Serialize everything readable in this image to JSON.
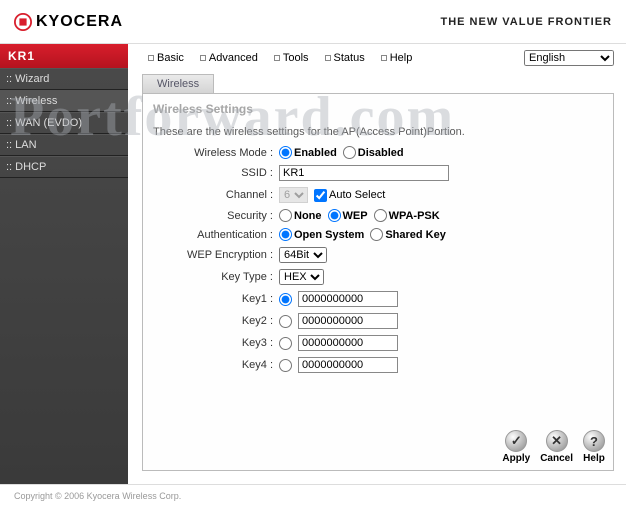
{
  "watermark": "Portforward.com",
  "brand": {
    "name": "KYOCERA",
    "tagline": "THE NEW VALUE FRONTIER"
  },
  "sidebar": {
    "head": "KR1",
    "items": [
      {
        "label": ":: Wizard"
      },
      {
        "label": ":: Wireless"
      },
      {
        "label": ":: WAN (EVDO)"
      },
      {
        "label": ":: LAN"
      },
      {
        "label": ":: DHCP"
      }
    ]
  },
  "topnav": {
    "items": [
      {
        "label": "Basic"
      },
      {
        "label": "Advanced"
      },
      {
        "label": "Tools"
      },
      {
        "label": "Status"
      },
      {
        "label": "Help"
      }
    ],
    "language": "English"
  },
  "tab": "Wireless",
  "panel": {
    "title": "Wireless Settings",
    "desc": "These are the wireless settings for the AP(Access Point)Portion.",
    "labels": {
      "mode": "Wireless Mode :",
      "ssid": "SSID :",
      "channel": "Channel :",
      "security": "Security :",
      "auth": "Authentication :",
      "wep": "WEP Encryption :",
      "keytype": "Key Type :",
      "key1": "Key1 :",
      "key2": "Key2 :",
      "key3": "Key3 :",
      "key4": "Key4 :"
    },
    "values": {
      "ssid": "KR1",
      "channel": "6",
      "autoselect": "Auto Select",
      "wep": "64Bit",
      "keytype": "HEX",
      "key1": "0000000000",
      "key2": "0000000000",
      "key3": "0000000000",
      "key4": "0000000000"
    },
    "options": {
      "mode": [
        "Enabled",
        "Disabled"
      ],
      "security": [
        "None",
        "WEP",
        "WPA-PSK"
      ],
      "auth": [
        "Open System",
        "Shared Key"
      ]
    }
  },
  "buttons": {
    "apply": "Apply",
    "cancel": "Cancel",
    "help": "Help"
  },
  "footer": "Copyright © 2006 Kyocera Wireless Corp."
}
